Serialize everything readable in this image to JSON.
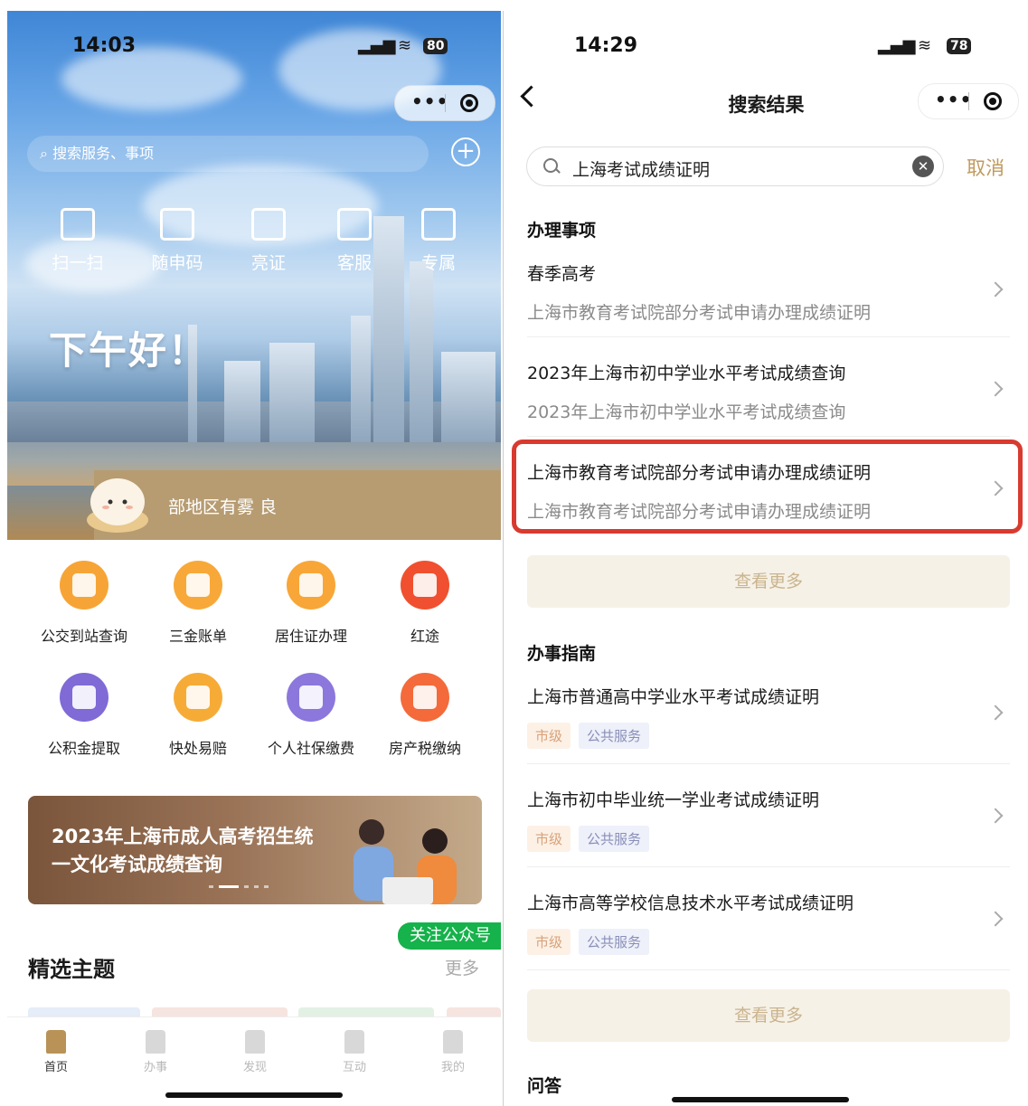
{
  "left": {
    "status": {
      "time": "14:03",
      "battery": "80"
    },
    "search_placeholder": "搜索服务、事项",
    "quick_actions": [
      "扫一扫",
      "随申码",
      "亮证",
      "客服",
      "专属"
    ],
    "greeting": "下午好！",
    "weather": "部地区有雾 良",
    "services": [
      "公交到站查询",
      "三金账单",
      "居住证办理",
      "红途",
      "公积金提取",
      "快处易赔",
      "个人社保缴费",
      "房产税缴纳"
    ],
    "banner_text": "2023年上海市成人高考招生统一文化考试成绩查询",
    "follow_button": "关注公众号",
    "topics_title": "精选主题",
    "topics_more": "更多",
    "tabs": [
      "首页",
      "办事",
      "发现",
      "互动",
      "我的"
    ]
  },
  "right": {
    "status": {
      "time": "14:29",
      "battery": "78"
    },
    "nav_title": "搜索结果",
    "search_value": "上海考试成绩证明",
    "cancel": "取消",
    "section_items": "办理事项",
    "items": [
      {
        "title": "春季高考",
        "sub": "上海市教育考试院部分考试申请办理成绩证明"
      },
      {
        "title": "2023年上海市初中学业水平考试成绩查询",
        "sub": "2023年上海市初中学业水平考试成绩查询"
      },
      {
        "title": "上海市教育考试院部分考试申请办理成绩证明",
        "sub": "上海市教育考试院部分考试申请办理成绩证明"
      }
    ],
    "more_label": "查看更多",
    "section_guides": "办事指南",
    "guides": [
      {
        "title": "上海市普通高中学业水平考试成绩证明",
        "tag1": "市级",
        "tag2": "公共服务"
      },
      {
        "title": "上海市初中毕业统一学业考试成绩证明",
        "tag1": "市级",
        "tag2": "公共服务"
      },
      {
        "title": "上海市高等学校信息技术水平考试成绩证明",
        "tag1": "市级",
        "tag2": "公共服务"
      }
    ],
    "section_qa": "问答"
  },
  "colors": {
    "accent_gold": "#c09a5d",
    "highlight_red": "#d93a2f",
    "follow_green": "#16b24b"
  }
}
